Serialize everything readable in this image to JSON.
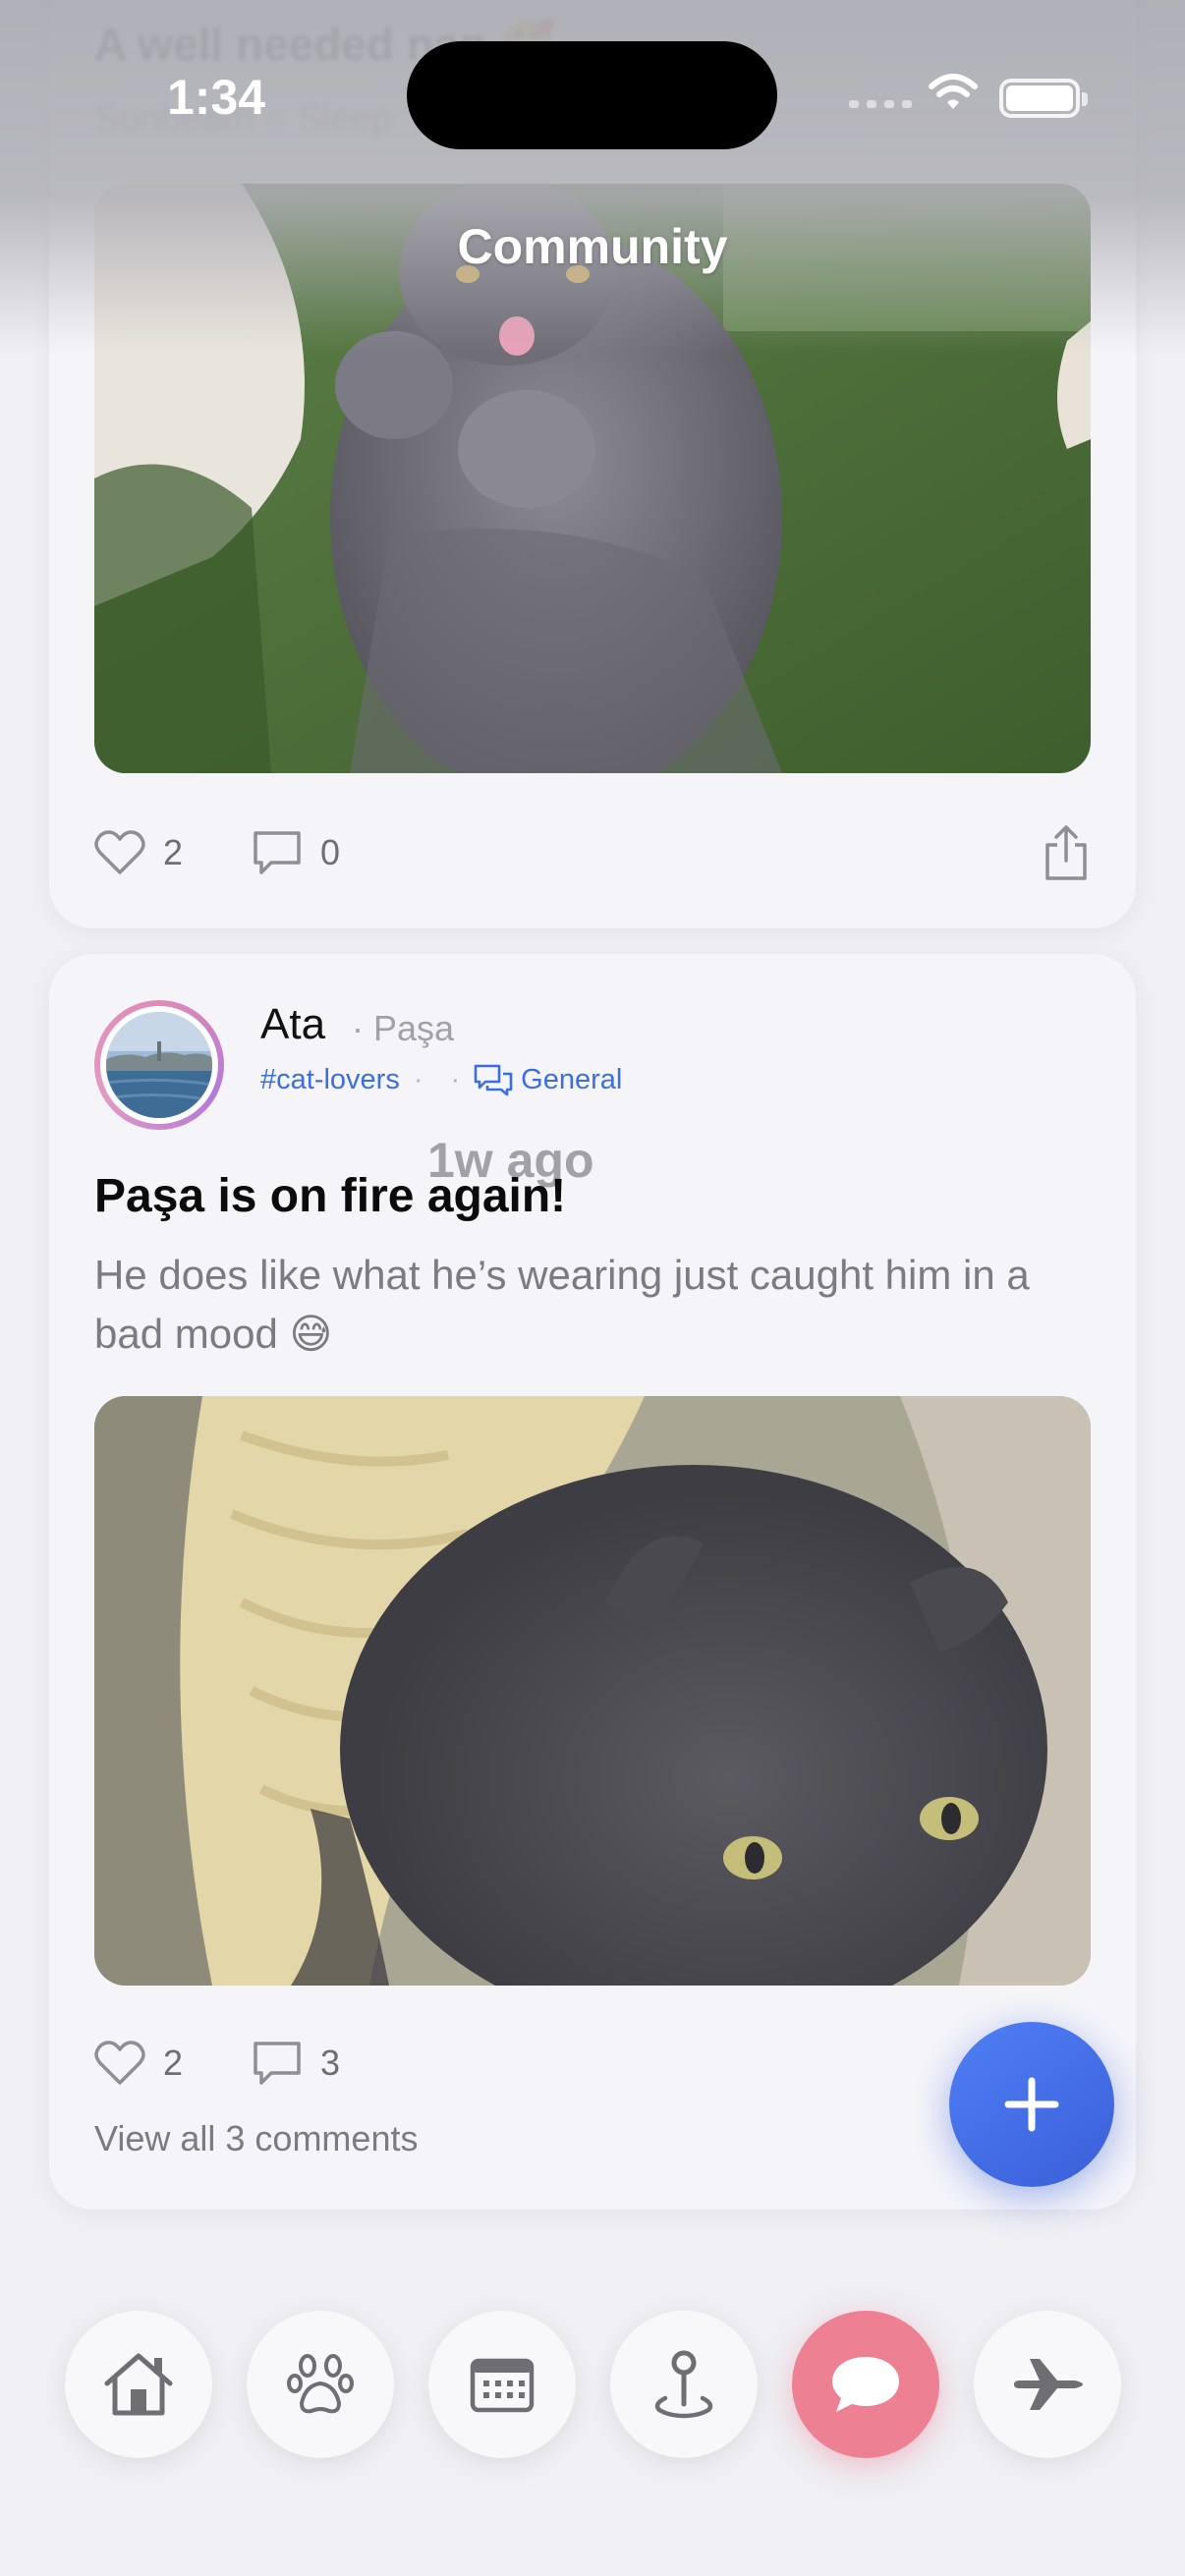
{
  "status_bar": {
    "time": "1:34"
  },
  "header": {
    "title": "Community"
  },
  "post_prev": {
    "title_partial": "A well needed nap 🥰",
    "subtitle_partial": "Sunbeam = Sleep",
    "likes": "2",
    "comments": "0"
  },
  "post": {
    "author": "Ata",
    "pet": "· Paşa",
    "hashtag": "#cat-lovers",
    "time_ago": "1w ago",
    "category": "General",
    "title": "Paşa is on fire again!",
    "body": "He does like what he’s wearing just caught him in a bad mood 😅",
    "likes": "2",
    "comments": "3",
    "view_all": "View all 3 comments"
  },
  "tabs": [
    {
      "name": "home",
      "icon": "home-icon"
    },
    {
      "name": "pets",
      "icon": "paw-icon"
    },
    {
      "name": "calendar",
      "icon": "calendar-icon"
    },
    {
      "name": "map",
      "icon": "location-pin-icon"
    },
    {
      "name": "community",
      "icon": "chat-bubble-icon",
      "active": true
    },
    {
      "name": "travel",
      "icon": "airplane-icon"
    }
  ],
  "colors": {
    "accent": "#3d6ee0",
    "active_tab": "#ee8093",
    "fab": "#4a78ee"
  }
}
